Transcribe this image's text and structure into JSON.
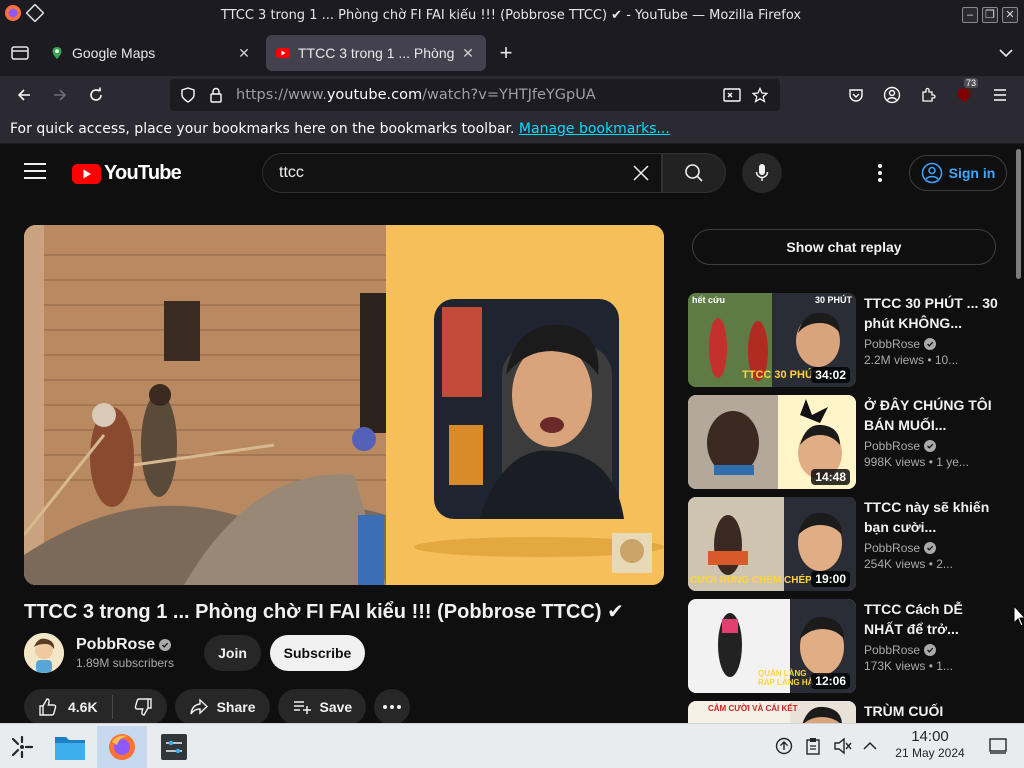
{
  "window": {
    "title": "TTCC 3 trong 1 ... Phòng chờ FI FAI kiểu !!! (Pobbrose TTCC) ✔ - YouTube — Mozilla Firefox"
  },
  "tabs": [
    {
      "label": "Google Maps",
      "icon": "google-maps-pin-icon",
      "active": false
    },
    {
      "label": "TTCC 3 trong 1 ... Phòng",
      "icon": "youtube-favicon",
      "active": true
    }
  ],
  "navbar": {
    "url_prefix": "https://www.",
    "url_domain": "youtube.com",
    "url_path": "/watch?v=YHTJfeYGpUA",
    "extensions_badge": "73"
  },
  "bookmarks": {
    "message": "For quick access, place your bookmarks here on the bookmarks toolbar.",
    "link": "Manage bookmarks..."
  },
  "youtube": {
    "logo_text": "YouTube",
    "search_value": "ttcc",
    "sign_in": "Sign in",
    "video": {
      "title": "TTCC 3 trong 1 ... Phòng chờ FI FAI kiểu !!! (Pobbrose TTCC) ✔",
      "channel": "PobbRose",
      "subscribers": "1.89M subscribers",
      "join": "Join",
      "subscribe": "Subscribe",
      "likes": "4.6K",
      "share": "Share",
      "save": "Save"
    },
    "chat_replay": "Show chat replay",
    "recommendations": [
      {
        "title": "TTCC 30 PHÚT ... 30 phút KHÔNG...",
        "channel": "PobbRose",
        "views": "2.2M views • 10...",
        "duration": "34:02",
        "thumb_text_top": "hết cứu",
        "thumb_text_right": "30 PHÚT",
        "thumb_text_bottom": "TTCC 30 PHÚT"
      },
      {
        "title": "Ở ĐÂY CHÚNG TÔI BÁN MUỐI...",
        "channel": "PobbRose",
        "views": "998K views • 1 ye...",
        "duration": "14:48",
        "thumb_text_top": "",
        "thumb_text_right": "",
        "thumb_text_bottom": ""
      },
      {
        "title": "TTCC này sẽ khiến bạn cười...",
        "channel": "PobbRose",
        "views": "254K views • 2...",
        "duration": "19:00",
        "thumb_text_top": "",
        "thumb_text_right": "",
        "thumb_text_bottom": "CƯỜI RUNG CHÉM CHÉP"
      },
      {
        "title": "TTCC Cách DỄ NHẤT để trở...",
        "channel": "PobbRose",
        "views": "173K views • 1...",
        "duration": "12:06",
        "thumb_text_top": "",
        "thumb_text_right": "",
        "thumb_text_bottom": "QUẢN LÀNG RAP LÀNG HÀ"
      },
      {
        "title": "TRÙM CUỐI",
        "channel": "",
        "views": "",
        "duration": "",
        "thumb_text_top": "CẢM CƯỜI VÀ CÁI KẾT",
        "thumb_text_right": "",
        "thumb_text_bottom": ""
      }
    ]
  },
  "taskbar": {
    "time": "14:00",
    "date": "21 May 2024"
  },
  "colors": {
    "youtube_red": "#ff0000",
    "link_blue": "#3ea6ff",
    "player_bg": "#f6bf5a",
    "taskbar_bg": "#e9ecef"
  }
}
